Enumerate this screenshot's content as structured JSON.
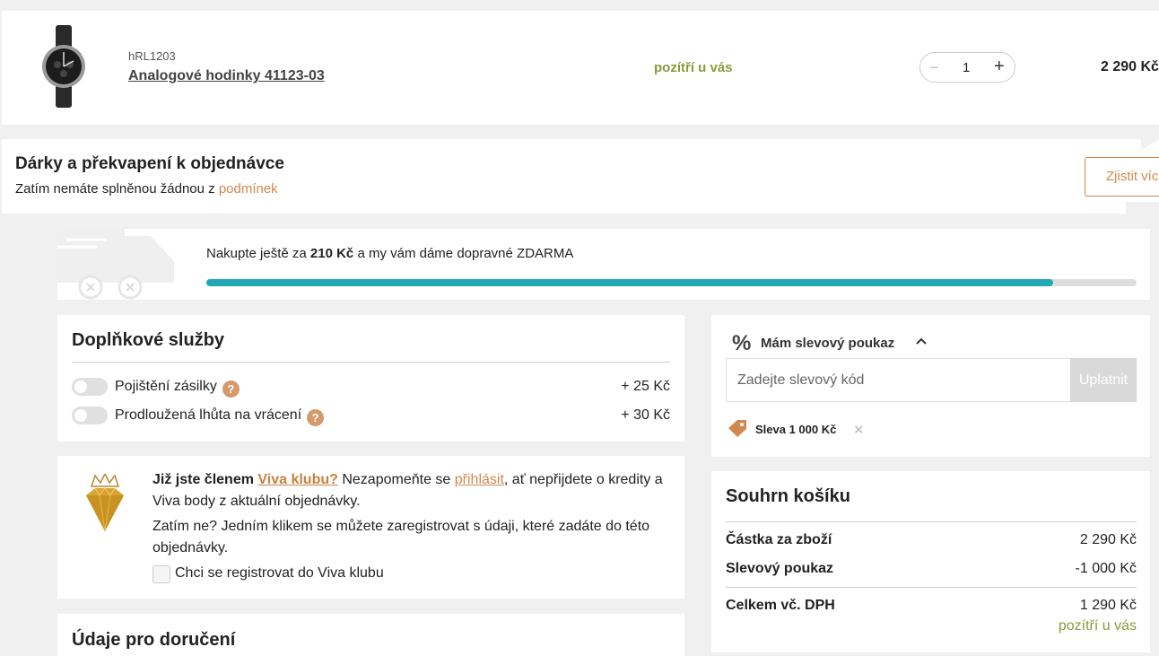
{
  "product": {
    "sku": "hRL1203",
    "name": "Analogové hodinky 41123-03",
    "availability": "pozítří u vás",
    "quantity": "1",
    "price": "2 290 Kč"
  },
  "gifts": {
    "title": "Dárky a překvapení k objednávce",
    "text": "Zatím nemáte splněnou žádnou z ",
    "link": "podmínek",
    "button": "Zjistit více"
  },
  "shipping": {
    "text_before": "Nakupte ještě za ",
    "amount": "210 Kč",
    "text_after": " a my vám dáme dopravné ZDARMA",
    "progress": 0.91
  },
  "services": {
    "title": "Doplňkové služby",
    "items": [
      {
        "label": "Pojištění zásilky",
        "price": "+ 25 Kč"
      },
      {
        "label": "Prodloužená lhůta na vrácení",
        "price": "+ 30 Kč"
      }
    ],
    "help_glyph": "?"
  },
  "viva": {
    "q_bold": "Již jste členem ",
    "q_link": "Viva klubu?",
    "q_text": " Nezapomeňte se ",
    "login_link": "přihlásit",
    "q_rest": ", ať nepřijdete o kredity a Viva body z aktuální objednávky.",
    "p2": "Zatím ne? Jedním klikem se můžete zaregistrovat s údaji, které zadáte do této objednávky.",
    "checkbox_label": "Chci se registrovat do Viva klubu"
  },
  "delivery": {
    "title": "Údaje pro doručení"
  },
  "voucher": {
    "icon_glyph": "%",
    "title": "Mám slevový poukaz",
    "placeholder": "Zadejte slevový kód",
    "button": "Uplatnit",
    "applied": "Sleva 1 000 Kč",
    "remove_glyph": "✕"
  },
  "summary": {
    "title": "Souhrn košíku",
    "rows": [
      {
        "label": "Částka za zboží",
        "value": "2 290 Kč"
      },
      {
        "label": "Slevový poukaz",
        "value": "-1 000 Kč"
      }
    ],
    "total_label": "Celkem vč. DPH",
    "total_value": "1 290 Kč",
    "availability": "pozítří u vás"
  },
  "colors": {
    "accent": "#d1884e",
    "progress": "#1fa9b5",
    "availability": "#8a9a3a"
  },
  "icons": [
    "watch-image",
    "truck-icon",
    "help-icon",
    "diamond-icon",
    "percent-icon",
    "chevron-up-icon",
    "tag-icon",
    "close-icon"
  ]
}
